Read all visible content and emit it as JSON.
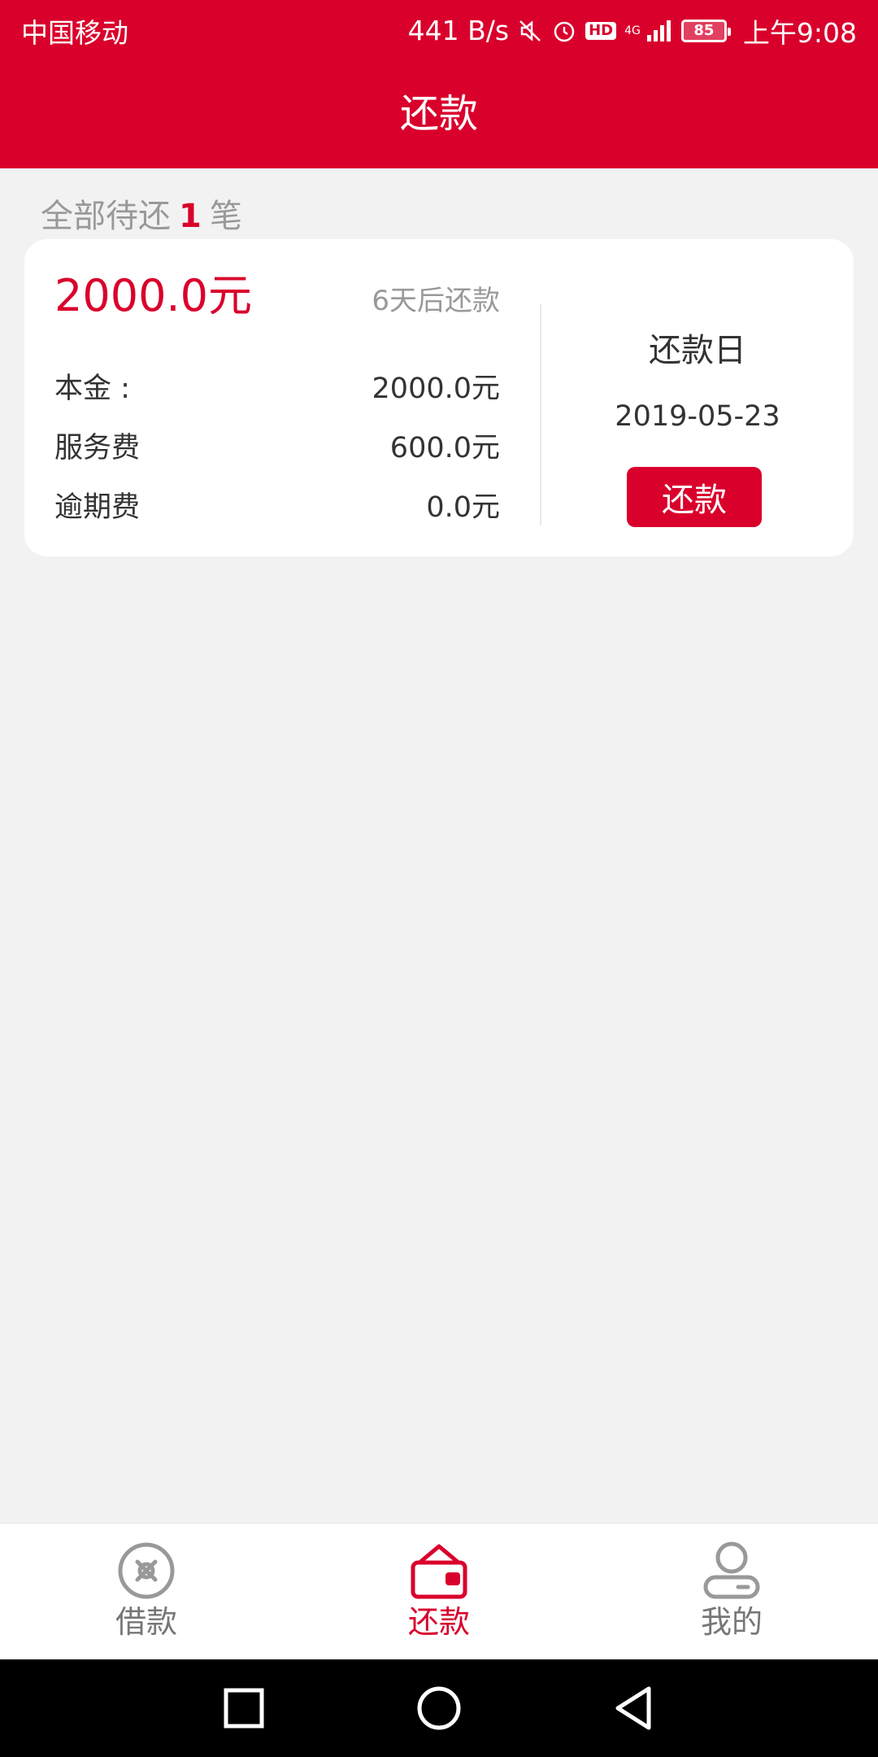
{
  "status_bar": {
    "carrier": "中国移动",
    "net_speed": "441 B/s",
    "hd": "HD",
    "network": "4G",
    "battery": "85",
    "time": "上午9:08"
  },
  "header": {
    "title": "还款"
  },
  "summary": {
    "prefix": "全部待还",
    "count": "1",
    "suffix": "笔"
  },
  "loan": {
    "amount": "2000.0元",
    "due_in": "6天后还款",
    "rows": [
      {
        "label": "本金 :",
        "value": "2000.0元"
      },
      {
        "label": "服务费",
        "value": "600.0元"
      },
      {
        "label": "逾期费",
        "value": "0.0元"
      }
    ],
    "due_label": "还款日",
    "due_date": "2019-05-23",
    "repay_button": "还款"
  },
  "tabs": [
    {
      "label": "借款",
      "icon": "coin-icon",
      "active": false
    },
    {
      "label": "还款",
      "icon": "wallet-icon",
      "active": true
    },
    {
      "label": "我的",
      "icon": "user-icon",
      "active": false
    }
  ],
  "colors": {
    "brand": "#d9002c",
    "background": "#f2f2f2",
    "muted": "#999999"
  }
}
